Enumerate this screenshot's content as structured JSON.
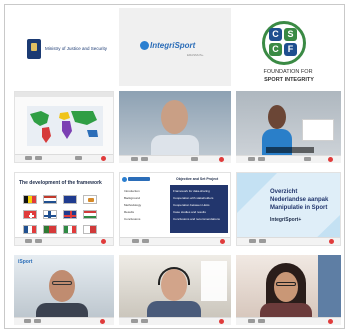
{
  "logos": {
    "ministry_text": "Ministry of Justice and Security",
    "integrisport_text": "IntegriSport",
    "integrisport_subtext": "ERASMUS+",
    "cscf_letters": [
      "C",
      "S",
      "C",
      "F"
    ],
    "cscf_caption_line1": "FOUNDATION FOR",
    "cscf_caption_line2": "SPORT INTEGRITY"
  },
  "slides": {
    "flags_title": "The development of the framework",
    "contents_header": "Objective and Set Project",
    "contents_left_items": [
      "Introduction",
      "Background",
      "Methodology",
      "Results",
      "Conclusions"
    ],
    "contents_right_items": [
      "Framework for data-sharing",
      "Cooperation with stakeholders",
      "Cooperation between LEAs",
      "Case studies and results",
      "Conclusions and recommendations"
    ],
    "overview_title_line1": "Overzicht",
    "overview_title_line2": "Nederlandse aanpak",
    "overview_title_line3": "Manipulatie in Sport",
    "overview_logo": "IntegriSport+",
    "sport_label": "iSport"
  },
  "colors": {
    "cscf_blue": "#1f4f8f",
    "cscf_green": "#3a8a44",
    "slide_navy": "#22366d",
    "record_red": "#e03b3b",
    "toolbar_bg": "#f3f3f3"
  }
}
